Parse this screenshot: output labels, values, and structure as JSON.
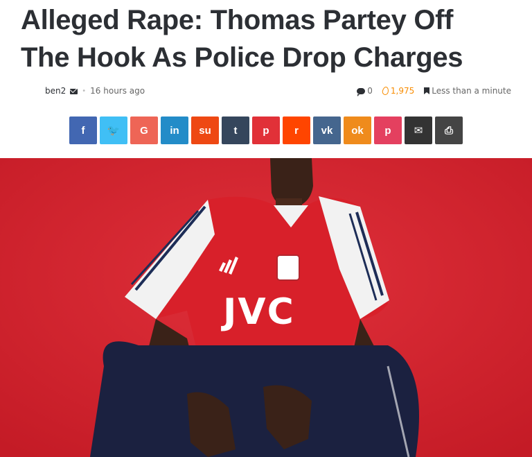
{
  "post": {
    "title_line1": "Alleged Rape: Thomas Partey Off",
    "title_line2": "The Hook As Police Drop Charges",
    "author": "ben2",
    "time_ago": "16 hours ago",
    "comments": "0",
    "views": "1,975",
    "read_time": "Less than a minute"
  },
  "share": [
    {
      "name": "facebook",
      "glyph": "f",
      "color": "#4267b2"
    },
    {
      "name": "twitter",
      "glyph": "🐦",
      "color": "#40bff5"
    },
    {
      "name": "google",
      "glyph": "G",
      "color": "#ee6556"
    },
    {
      "name": "linkedin",
      "glyph": "in",
      "color": "#238cc8"
    },
    {
      "name": "stumbleupon",
      "glyph": "su",
      "color": "#ee4813"
    },
    {
      "name": "tumblr",
      "glyph": "t",
      "color": "#35465c"
    },
    {
      "name": "pinterest",
      "glyph": "p",
      "color": "#e13138"
    },
    {
      "name": "reddit",
      "glyph": "r",
      "color": "#ff4500"
    },
    {
      "name": "vk",
      "glyph": "vk",
      "color": "#45668e"
    },
    {
      "name": "odnoklassniki",
      "glyph": "ok",
      "color": "#ef8b1c"
    },
    {
      "name": "pocket",
      "glyph": "p",
      "color": "#e4405f"
    },
    {
      "name": "email",
      "glyph": "✉",
      "color": "#333333"
    },
    {
      "name": "print",
      "glyph": "⎙",
      "color": "#444444"
    }
  ],
  "hero": {
    "shirt_sponsor": "JVC",
    "background_color": "#d5222e"
  }
}
